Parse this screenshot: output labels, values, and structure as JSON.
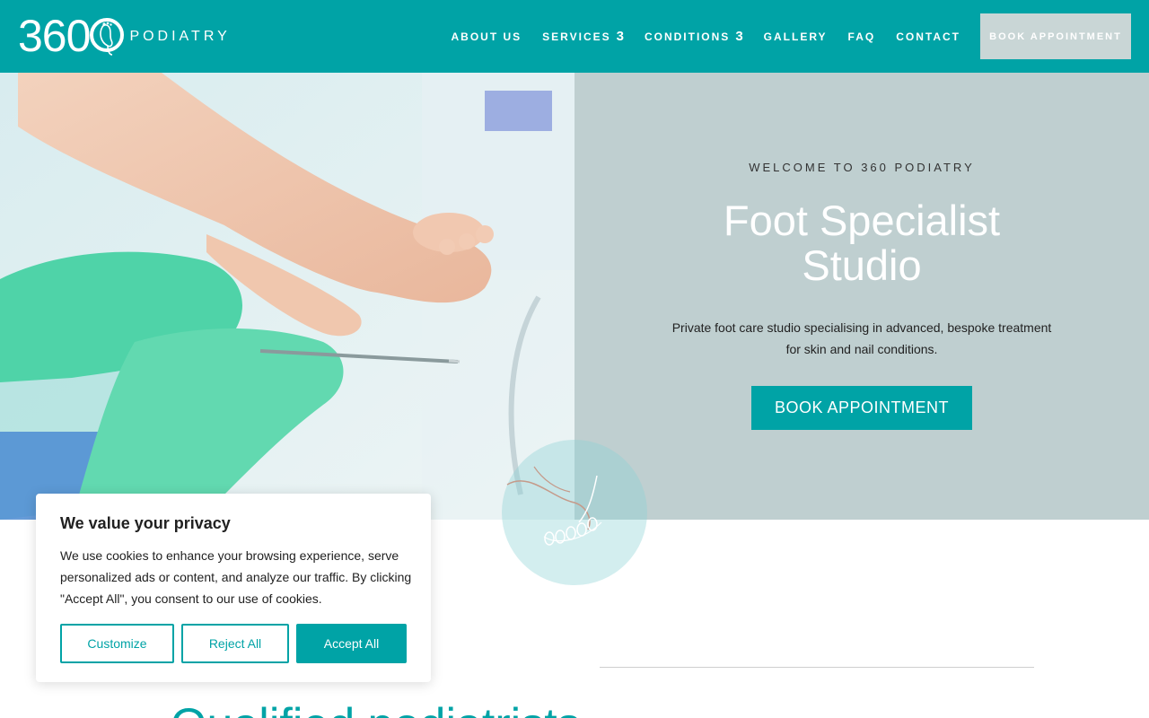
{
  "brand": {
    "logo_number": "360",
    "logo_word": "PODIATRY"
  },
  "nav": {
    "items": [
      {
        "label": "ABOUT US",
        "has_dropdown": false
      },
      {
        "label": "SERVICES",
        "has_dropdown": true
      },
      {
        "label": "CONDITIONS",
        "has_dropdown": true
      },
      {
        "label": "GALLERY",
        "has_dropdown": false
      },
      {
        "label": "FAQ",
        "has_dropdown": false
      },
      {
        "label": "CONTACT",
        "has_dropdown": false
      }
    ],
    "dropdown_glyph": "3",
    "book_label": "BOOK APPOINTMENT"
  },
  "hero": {
    "welcome": "WELCOME TO 360 PODIATRY",
    "title_line1": "Foot Specialist",
    "title_line2": "Studio",
    "description": "Private foot care studio specialising in advanced, bespoke treatment for skin and nail conditions.",
    "button_label": "BOOK APPOINTMENT",
    "image_icon": "podiatry-treatment-photo"
  },
  "section": {
    "heading": "Qualified podiatrists"
  },
  "cookie": {
    "title": "We value your privacy",
    "text": "We use cookies to enhance your browsing experience, serve personalized ads or content, and analyze our traffic. By clicking \"Accept All\", you consent to our use of cookies.",
    "customize_label": "Customize",
    "reject_label": "Reject All",
    "accept_label": "Accept All"
  },
  "colors": {
    "brand_teal": "#00a3a6",
    "hero_panel": "#bfcfd0",
    "book_button_bg": "#c9d6d6"
  }
}
